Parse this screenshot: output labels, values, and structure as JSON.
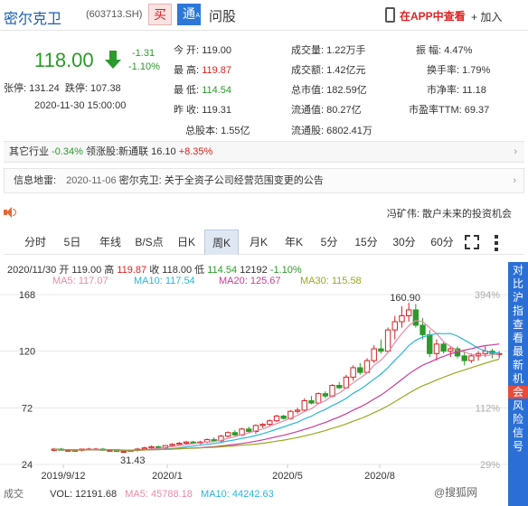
{
  "header": {
    "stock_name": "密尔克卫",
    "stock_code": "(603713.SH)",
    "buy_label": "买",
    "tong_label": "通",
    "tong_sub": "A",
    "ask_label": "问股",
    "app_label": "在APP中查看",
    "add_label": "+ 加入"
  },
  "price": {
    "current": "118.00",
    "change": "-1.31",
    "change_pct": "-1.10%",
    "limit_up_label": "张停:",
    "limit_up": "131.24",
    "limit_down_label": "跌停:",
    "limit_down": "107.38",
    "timestamp": "2020-11-30 15:00:00",
    "up_color": "#d22222",
    "down_color": "#2a9a2a"
  },
  "quote": {
    "open_label": "今    开:",
    "open": "119.00",
    "high_label": "最    高:",
    "high": "119.87",
    "low_label": "最    低:",
    "low": "114.54",
    "prev_label": "昨    收:",
    "prev": "119.31",
    "shares_label": "总股本:",
    "shares": "1.55亿",
    "volume_label": "成交量:",
    "volume": "1.22万手",
    "amount_label": "成交额:",
    "amount": "1.42亿元",
    "mcap_label": "总市值:",
    "mcap": "182.59亿",
    "float_mcap_label": "流通值:",
    "float_mcap": "80.27亿",
    "float_shares_label": "流通股:",
    "float_shares": "6802.41万",
    "amp_label": "振      幅:",
    "amp": "4.47%",
    "turnover_label": "换手率:",
    "turnover": "1.79%",
    "pb_label": "市净率:",
    "pb": "11.18",
    "pe_label": "市盈率TTM:",
    "pe": "69.37"
  },
  "industry": {
    "label": "其它行业",
    "pct": "-0.34%",
    "leader_label": "领涨股:",
    "leader": "新通联",
    "leader_price": "16.10",
    "leader_pct": "+8.35%"
  },
  "news": {
    "label": "信息地雷:",
    "date": "2020-11-06",
    "text": "密尔克卫: 关于全资子公司经营范围变更的公告"
  },
  "ticker": "冯矿伟: 散户未来的投资机会",
  "tabs": [
    "分时",
    "5日",
    "年线",
    "B/S点",
    "日K",
    "周K",
    "月K",
    "年K",
    "5分",
    "15分",
    "30分",
    "60分"
  ],
  "active_tab": "周K",
  "ohlc": {
    "date": "2020/11/30",
    "open_label": "开",
    "open": "119.00",
    "high_label": "高",
    "high": "119.87",
    "close_label": "收",
    "close": "118.00",
    "low_label": "低",
    "low": "114.54",
    "vol": "12192",
    "pct": "-1.10%"
  },
  "ma": {
    "ma5": "MA5: 117.07",
    "ma10": "MA10: 117.54",
    "ma20": "MA20: 125.67",
    "ma30": "MA30: 115.58",
    "colors": {
      "ma5": "#e88aa8",
      "ma10": "#2ab5d9",
      "ma20": "#c93a9a",
      "ma30": "#9aa81e"
    }
  },
  "chart_data": {
    "type": "candlestick",
    "x_ticks": [
      "2019/9/12",
      "2020/1",
      "2020/5",
      "2020/8"
    ],
    "y_ticks": [
      168,
      120,
      72,
      24
    ],
    "y_range": [
      24,
      168
    ],
    "right_ticks": [
      "394%",
      "112%",
      "29%"
    ],
    "high_label": "160.90",
    "low_label": "31.43",
    "candles": [
      [
        36,
        38,
        35,
        37
      ],
      [
        37,
        38,
        36,
        36
      ],
      [
        36,
        37,
        35,
        36
      ],
      [
        36,
        37,
        35,
        36
      ],
      [
        36,
        37,
        35,
        37
      ],
      [
        37,
        38,
        36,
        37
      ],
      [
        37,
        38,
        36,
        37
      ],
      [
        37,
        38,
        36,
        36
      ],
      [
        36,
        37,
        35,
        36
      ],
      [
        36,
        36,
        35,
        35
      ],
      [
        35,
        36,
        34,
        35
      ],
      [
        35,
        36,
        35,
        36
      ],
      [
        36,
        38,
        35,
        37
      ],
      [
        37,
        39,
        36,
        38
      ],
      [
        38,
        40,
        37,
        39
      ],
      [
        39,
        40,
        37,
        38
      ],
      [
        38,
        40,
        37,
        40
      ],
      [
        40,
        42,
        39,
        41
      ],
      [
        41,
        43,
        40,
        42
      ],
      [
        42,
        44,
        41,
        43
      ],
      [
        43,
        44,
        41,
        42
      ],
      [
        42,
        44,
        41,
        43
      ],
      [
        43,
        46,
        42,
        45
      ],
      [
        45,
        47,
        43,
        44
      ],
      [
        44,
        49,
        43,
        48
      ],
      [
        48,
        52,
        47,
        51
      ],
      [
        51,
        53,
        48,
        49
      ],
      [
        49,
        55,
        48,
        54
      ],
      [
        54,
        56,
        51,
        52
      ],
      [
        52,
        58,
        50,
        57
      ],
      [
        57,
        59,
        55,
        58
      ],
      [
        58,
        62,
        56,
        61
      ],
      [
        61,
        66,
        60,
        65
      ],
      [
        65,
        66,
        62,
        63
      ],
      [
        63,
        70,
        62,
        69
      ],
      [
        69,
        72,
        67,
        70
      ],
      [
        70,
        80,
        69,
        78
      ],
      [
        78,
        82,
        75,
        76
      ],
      [
        76,
        85,
        75,
        84
      ],
      [
        84,
        86,
        80,
        82
      ],
      [
        82,
        92,
        81,
        91
      ],
      [
        91,
        94,
        88,
        89
      ],
      [
        89,
        100,
        88,
        98
      ],
      [
        98,
        108,
        95,
        106
      ],
      [
        106,
        110,
        100,
        102
      ],
      [
        102,
        114,
        101,
        112
      ],
      [
        112,
        125,
        110,
        122
      ],
      [
        122,
        130,
        118,
        120
      ],
      [
        120,
        140,
        119,
        138
      ],
      [
        138,
        150,
        130,
        145
      ],
      [
        145,
        158,
        140,
        150
      ],
      [
        150,
        161,
        145,
        155
      ],
      [
        155,
        160,
        140,
        142
      ],
      [
        142,
        148,
        130,
        134
      ],
      [
        134,
        138,
        115,
        118
      ],
      [
        118,
        130,
        112,
        126
      ],
      [
        126,
        128,
        118,
        120
      ],
      [
        120,
        124,
        115,
        122
      ],
      [
        122,
        124,
        114,
        116
      ],
      [
        116,
        120,
        108,
        112
      ],
      [
        112,
        118,
        110,
        116
      ],
      [
        116,
        120,
        112,
        118
      ],
      [
        118,
        124,
        115,
        120
      ],
      [
        120,
        122,
        114,
        118
      ],
      [
        118,
        120,
        114,
        118
      ]
    ]
  },
  "side_panel": [
    "对",
    "比",
    "沪",
    "指",
    "查",
    "看",
    "最",
    "新",
    "机",
    "会",
    "风",
    "险",
    "信",
    "号"
  ],
  "volume": {
    "label": "成交",
    "vol": "VOL: 12191.68",
    "ma5": "MA5: 45788.18",
    "ma10": "MA10: 44242.63"
  },
  "watermark": "@搜狐网"
}
